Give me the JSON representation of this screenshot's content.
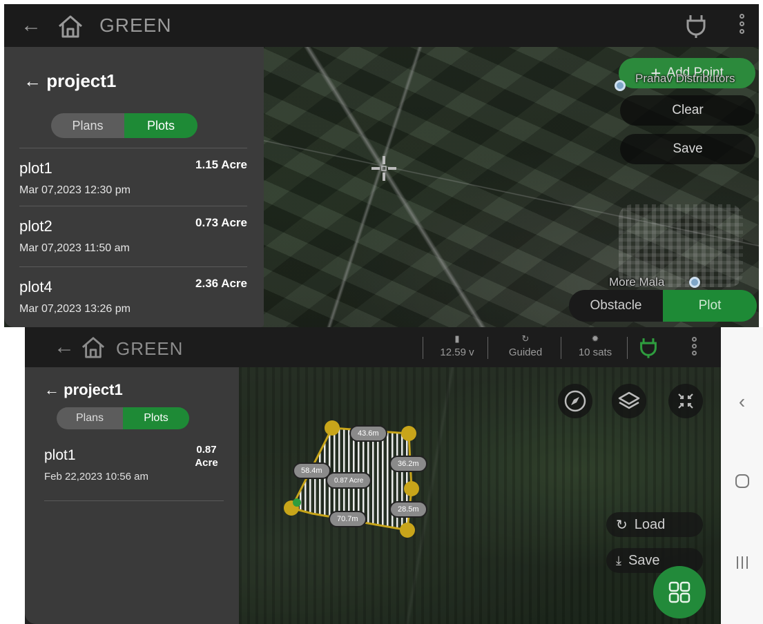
{
  "top": {
    "app_bar": {
      "brand": "GREEN"
    },
    "panel": {
      "project_title": "project1",
      "segments": [
        "Plans",
        "Plots"
      ],
      "plots": [
        {
          "name": "plot1",
          "date": "Mar 07,2023 12:30 pm",
          "area": "1.15 Acre"
        },
        {
          "name": "plot2",
          "date": "Mar 07,2023 11:50 am",
          "area": "0.73 Acre"
        },
        {
          "name": "plot4",
          "date": "Mar 07,2023 13:26 pm",
          "area": "2.36 Acre"
        }
      ]
    },
    "map": {
      "add_point": "Add Point",
      "clear": "Clear",
      "save": "Save",
      "place_label_1": "Pranav Distributors",
      "place_label_2": "More Mala",
      "mode_obstacle": "Obstacle",
      "mode_plot": "Plot"
    }
  },
  "bottom": {
    "app_bar": {
      "brand": "GREEN",
      "voltage": "12.59 v",
      "mode": "Guided",
      "sats": "10 sats"
    },
    "panel": {
      "project_title": "project1",
      "segments": [
        "Plans",
        "Plots"
      ],
      "plots": [
        {
          "name": "plot1",
          "date": "Feb 22,2023 10:56 am",
          "area": "0.87 Acre"
        }
      ]
    },
    "map": {
      "measurements": {
        "top": "43.6m",
        "right": "36.2m",
        "left": "58.4m",
        "area": "0.87 Acre",
        "bottom": "70.7m",
        "bottom_right": "28.5m"
      },
      "load": "Load",
      "save": "Save"
    }
  },
  "colors": {
    "accent_green": "#1e8a36",
    "panel_bg": "#3b3b3b",
    "bar_bg": "#1b1b1b",
    "polygon_yellow": "#c8a51a"
  }
}
